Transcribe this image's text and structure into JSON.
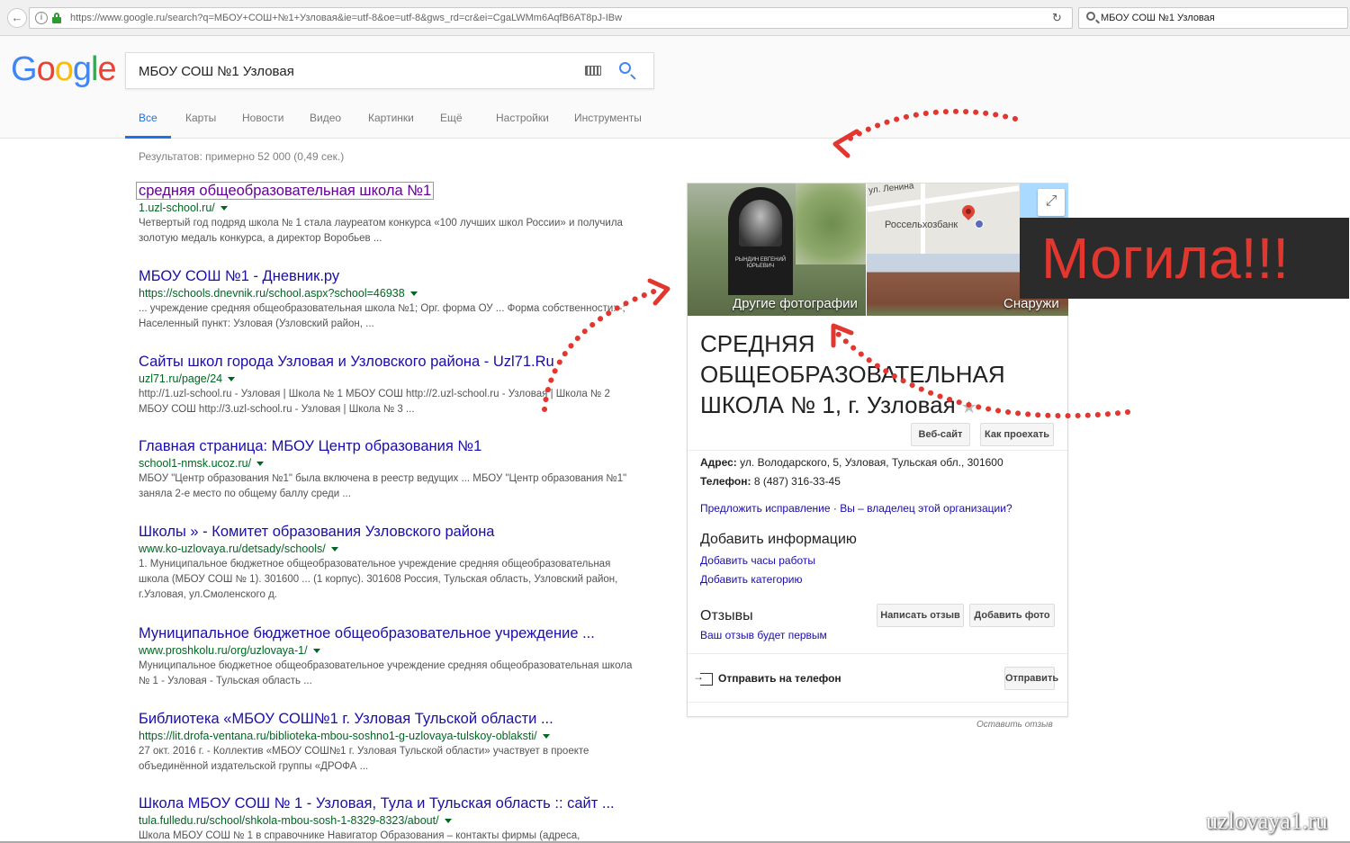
{
  "browser": {
    "url": "https://www.google.ru/search?q=МБОУ+СОШ+№1+Узловая&ie=utf-8&oe=utf-8&gws_rd=cr&ei=CgaLWMm6AqfB6AT8pJ-IBw",
    "search_value": "МБОУ СОШ №1 Узловая"
  },
  "google": {
    "query": "МБОУ СОШ №1 Узловая",
    "tabs": [
      "Все",
      "Карты",
      "Новости",
      "Видео",
      "Картинки",
      "Ещё",
      "Настройки",
      "Инструменты"
    ],
    "stats": "Результатов: примерно 52 000 (0,49 сек.)"
  },
  "results": [
    {
      "title": "средняя общеобразовательная школа №1",
      "url": "1.uzl-school.ru/",
      "snippet": "Четвертый год подряд школа № 1 стала лауреатом конкурса «100 лучших школ России» и получила золотую медаль конкурса, а директор Воробьев ..."
    },
    {
      "title": "МБОУ СОШ №1 - Дневник.ру",
      "url": "https://schools.dnevnik.ru/school.aspx?school=46938",
      "snippet": "... учреждение средняя общеобразовательная школа №1; Орг. форма ОУ ... Форма собственности: -; Населенный пункт: Узловая (Узловский район, ..."
    },
    {
      "title": "Сайты школ города Узловая и Узловского района - Uzl71.Ru",
      "url": "uzl71.ru/page/24",
      "snippet": "http://1.uzl-school.ru - Узловая | Школа № 1 МБОУ СОШ http://2.uzl-school.ru - Узловая | Школа № 2 МБОУ СОШ http://3.uzl-school.ru - Узловая | Школа № 3 ..."
    },
    {
      "title": "Главная страница: МБОУ Центр образования №1",
      "url": "school1-nmsk.ucoz.ru/",
      "snippet": "МБОУ \"Центр образования №1\" была включена в реестр ведущих ... МБОУ \"Центр образования №1\" заняла 2-е место по общему баллу среди ..."
    },
    {
      "title": "Школы » - Комитет образования Узловского района",
      "url": "www.ko-uzlovaya.ru/detsady/schools/",
      "snippet": "1. Муниципальное бюджетное общеобразовательное учреждение средняя общеобразовательная школа (МБОУ СОШ № 1). 301600 ... (1 корпус). 301608 Россия, Тульская область, Узловский район, г.Узловая, ул.Смоленского д."
    },
    {
      "title": "Муниципальное бюджетное общеобразовательное учреждение ...",
      "url": "www.proshkolu.ru/org/uzlovaya-1/",
      "snippet": "Муниципальное бюджетное общеобразовательное учреждение средняя общеобразовательная школа № 1 - Узловая - Тульская область ..."
    },
    {
      "title": "Библиотека «МБОУ СОШ№1 г. Узловая Тульской области ...",
      "url": "https://lit.drofa-ventana.ru/biblioteka-mbou-soshno1-g-uzlovaya-tulskoy-oblaksti/",
      "snippet": "27 окт. 2016 г. - Коллектив «МБОУ СОШ№1 г. Узловая Тульской области» участвует в проекте объединённой издательской группы «ДРОФА ..."
    },
    {
      "title": "Школа МБОУ СОШ № 1 - Узловая, Тула и Тульская область :: сайт ...",
      "url": "tula.fulledu.ru/school/shkola-mbou-sosh-1-8329-8323/about/",
      "snippet": "Школа МБОУ СОШ № 1 в справочнике Навигатор Образования – контакты фирмы (адреса,"
    }
  ],
  "knowledge_panel": {
    "photo_left_caption": "Другие фотографии",
    "photo_right_caption": "Снаружи",
    "map_street": "ул. Ленина",
    "map_bank": "Россельхозбанк",
    "tomb_text": "РЫНДИН ЕВГЕНИЙ ЮРЬЕВИЧ",
    "title": "СРЕДНЯЯ ОБЩЕОБРАЗОВАТЕЛЬНАЯ ШКОЛА № 1, г. Узловая",
    "btn_website": "Веб-сайт",
    "btn_directions": "Как проехать",
    "address_label": "Адрес:",
    "address_value": "ул. Володарского, 5, Узловая, Тульская обл., 301600",
    "phone_label": "Телефон:",
    "phone_value": "8 (487) 316-33-45",
    "suggest_edit": "Предложить исправление · Вы – владелец этой организации?",
    "add_info_heading": "Добавить информацию",
    "add_hours": "Добавить часы работы",
    "add_category": "Добавить категорию",
    "reviews_heading": "Отзывы",
    "first_review": "Ваш отзыв будет первым",
    "btn_write_review": "Написать отзыв",
    "btn_add_photo": "Добавить фото",
    "send_to_phone": "Отправить на телефон",
    "btn_send": "Отправить",
    "leave_review": "Оставить отзыв"
  },
  "annotation": {
    "banner_text": "Могила!!!",
    "arrow_color": "#e2372f"
  },
  "watermark": "uzlovaya1.ru"
}
